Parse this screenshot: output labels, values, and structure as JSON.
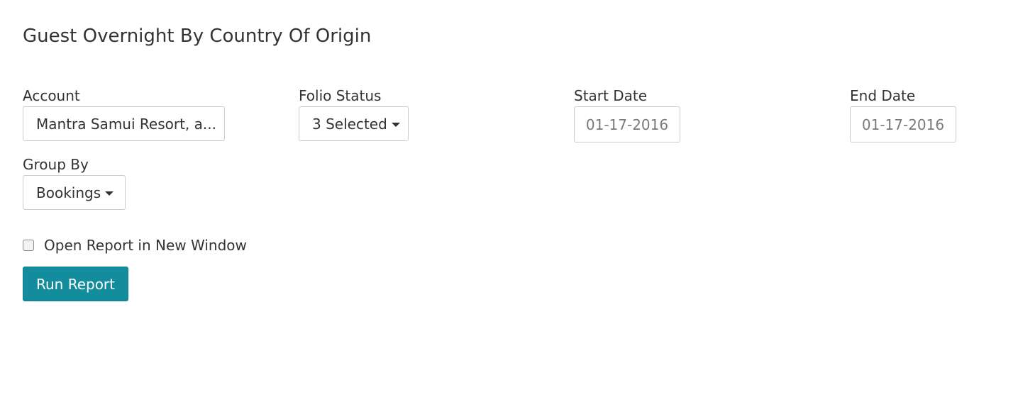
{
  "page": {
    "title": "Guest Overnight By Country Of Origin"
  },
  "account": {
    "label": "Account",
    "value": "Mantra Samui Resort, a..."
  },
  "folio_status": {
    "label": "Folio Status",
    "selected": "3 Selected"
  },
  "start_date": {
    "label": "Start Date",
    "value": "01-17-2016"
  },
  "end_date": {
    "label": "End Date",
    "value": "01-17-2016"
  },
  "group_by": {
    "label": "Group By",
    "selected": "Bookings"
  },
  "open_new_window": {
    "label": "Open Report in New Window",
    "checked": false
  },
  "actions": {
    "run_report_label": "Run Report"
  },
  "colors": {
    "primary_button": "#138d9e",
    "text": "#333333",
    "border": "#cccccc"
  }
}
